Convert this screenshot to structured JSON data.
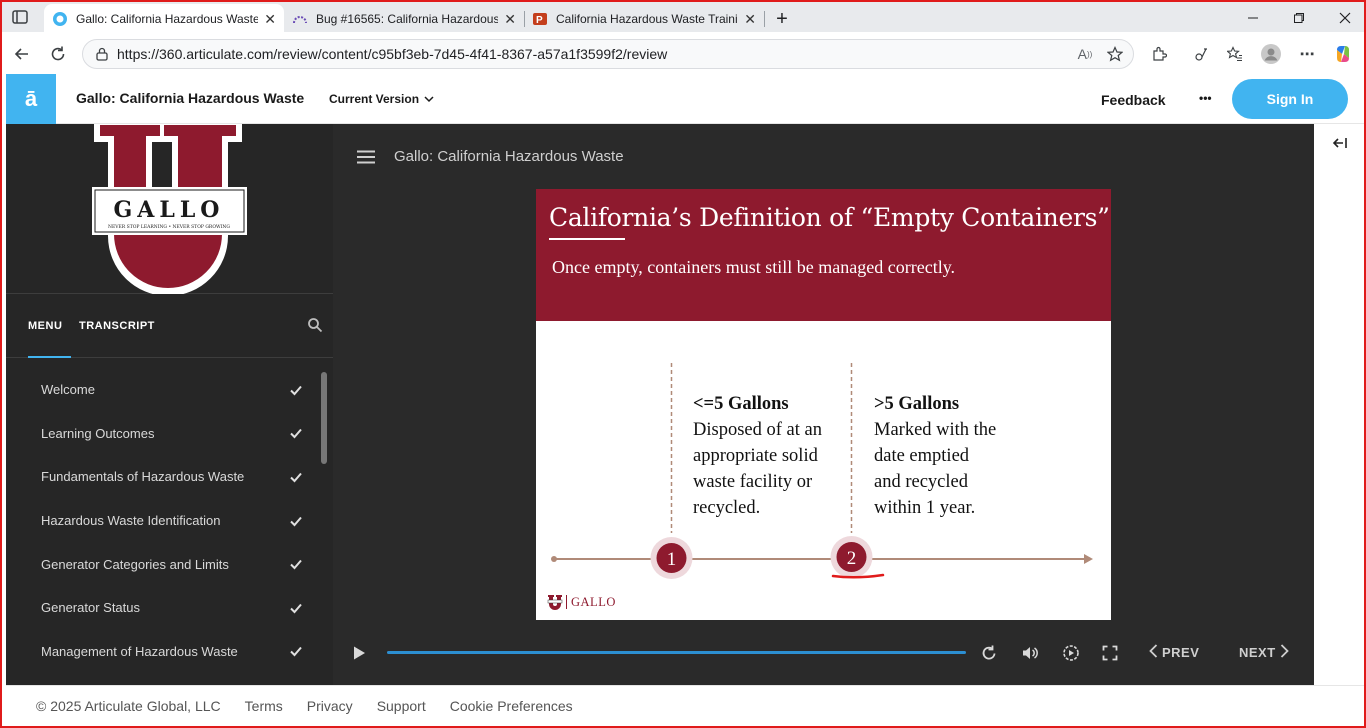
{
  "browser": {
    "tabs": [
      {
        "title": "Gallo: California Hazardous Waste",
        "close": "✕",
        "active": true
      },
      {
        "title": "Bug #16565: California Hazardous",
        "close": "✕",
        "active": false
      },
      {
        "title": "California Hazardous Waste Traini",
        "close": "✕",
        "active": false
      }
    ],
    "new_tab": "+",
    "url": "https://360.articulate.com/review/content/c95bf3eb-7d45-4f41-8367-a57a1f3599f2/review"
  },
  "header": {
    "logo_letter": "ā",
    "course_title": "Gallo: California Hazardous Waste",
    "version_label": "Current Version",
    "feedback_label": "Feedback",
    "more_label": "•••",
    "signin_label": "Sign In"
  },
  "sidebar": {
    "logo": {
      "word": "GALLO",
      "tagline": "NEVER STOP LEARNING • NEVER STOP GROWING"
    },
    "tabs": [
      {
        "label": "MENU",
        "active": true
      },
      {
        "label": "TRANSCRIPT",
        "active": false
      }
    ],
    "items": [
      {
        "label": "Welcome",
        "done": true
      },
      {
        "label": "Learning Outcomes",
        "done": true
      },
      {
        "label": "Fundamentals of Hazardous Waste",
        "done": true
      },
      {
        "label": "Hazardous Waste Identification",
        "done": true
      },
      {
        "label": "Generator Categories and Limits",
        "done": true
      },
      {
        "label": "Generator Status",
        "done": true
      },
      {
        "label": "Management of Hazardous Waste",
        "done": true
      }
    ]
  },
  "player": {
    "title": "Gallo: California Hazardous Waste",
    "prev_label": "PREV",
    "next_label": "NEXT",
    "progress": 1.0
  },
  "slide": {
    "heading": "California’s Definition of “Empty Containers”",
    "subheading": "Once empty, containers must still be managed correctly.",
    "columns": [
      {
        "marker": "1",
        "title": "<=5 Gallons",
        "lines": [
          "Disposed of at an",
          "appropriate solid",
          "waste facility or",
          "recycled."
        ]
      },
      {
        "marker": "2",
        "title": ">5 Gallons",
        "lines": [
          "Marked with the",
          "date emptied",
          "and recycled",
          "within 1 year."
        ]
      }
    ],
    "footer_brand": "GALLO"
  },
  "footer": {
    "copyright": "© 2025 Articulate Global, LLC",
    "links": [
      "Terms",
      "Privacy",
      "Support",
      "Cookie Preferences"
    ]
  },
  "colors": {
    "accent": "#41b4f0",
    "brand_maroon": "#8e1a2e",
    "sidebar_bg": "#262626",
    "player_bg": "#2a2a2a"
  }
}
